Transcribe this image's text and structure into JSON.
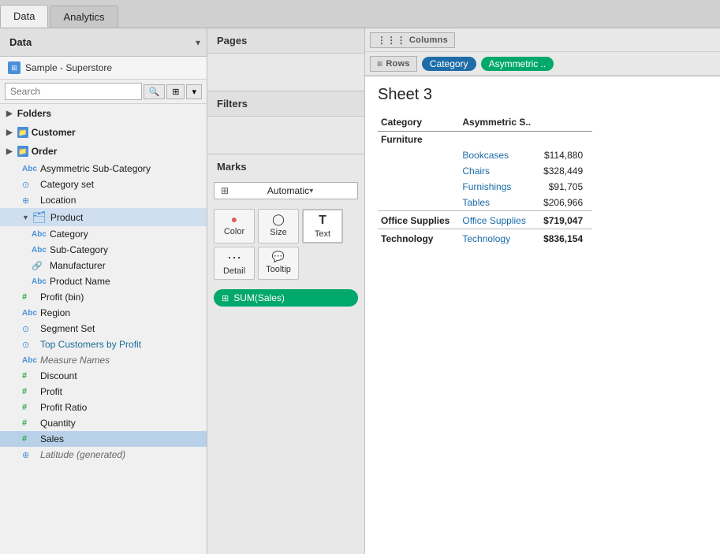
{
  "tabs": {
    "data_label": "Data",
    "analytics_label": "Analytics"
  },
  "left_panel": {
    "title": "Data",
    "datasource": "Sample - Superstore",
    "search_placeholder": "Search",
    "sections": {
      "folders_label": "Folders",
      "customer_label": "Customer",
      "order_label": "Order"
    },
    "items": [
      {
        "id": "asymmetric-sub-category",
        "icon": "Abc",
        "icon_color": "dim",
        "label": "Asymmetric Sub-Category",
        "indent": 1,
        "active": false
      },
      {
        "id": "category-set",
        "icon": "⊙",
        "icon_color": "set",
        "label": "Category set",
        "indent": 1,
        "active": false
      },
      {
        "id": "location",
        "icon": "⊕",
        "icon_color": "geo",
        "label": "Location",
        "indent": 1,
        "active": false
      },
      {
        "id": "product",
        "icon": "🗂",
        "icon_color": "dim",
        "label": "Product",
        "indent": 1,
        "active": true,
        "expanded": true
      },
      {
        "id": "category",
        "icon": "Abc",
        "icon_color": "dim",
        "label": "Category",
        "indent": 2,
        "active": false
      },
      {
        "id": "sub-category",
        "icon": "Abc",
        "icon_color": "dim",
        "label": "Sub-Category",
        "indent": 2,
        "active": false
      },
      {
        "id": "manufacturer",
        "icon": "🔗",
        "icon_color": "dim",
        "label": "Manufacturer",
        "indent": 2,
        "active": false
      },
      {
        "id": "product-name",
        "icon": "Abc",
        "icon_color": "dim",
        "label": "Product Name",
        "indent": 2,
        "active": false
      },
      {
        "id": "profit-bin",
        "icon": "#",
        "icon_color": "bin",
        "label": "Profit (bin)",
        "indent": 1,
        "active": false
      },
      {
        "id": "region",
        "icon": "Abc",
        "icon_color": "dim",
        "label": "Region",
        "indent": 1,
        "active": false
      },
      {
        "id": "segment-set",
        "icon": "⊙",
        "icon_color": "set",
        "label": "Segment Set",
        "indent": 1,
        "active": false
      },
      {
        "id": "top-customers",
        "icon": "⊙",
        "icon_color": "set",
        "label": "Top Customers by Profit",
        "indent": 1,
        "active": false,
        "blue": true
      },
      {
        "id": "measure-names",
        "icon": "Abc",
        "icon_color": "dim",
        "label": "Measure Names",
        "indent": 1,
        "active": false,
        "italic": true
      },
      {
        "id": "discount",
        "icon": "#",
        "icon_color": "measure",
        "label": "Discount",
        "indent": 1,
        "active": false
      },
      {
        "id": "profit",
        "icon": "#",
        "icon_color": "measure",
        "label": "Profit",
        "indent": 1,
        "active": false
      },
      {
        "id": "profit-ratio",
        "icon": "#",
        "icon_color": "measure",
        "label": "Profit Ratio",
        "indent": 1,
        "active": false
      },
      {
        "id": "quantity",
        "icon": "#",
        "icon_color": "measure",
        "label": "Quantity",
        "indent": 1,
        "active": false
      },
      {
        "id": "sales",
        "icon": "#",
        "icon_color": "measure",
        "label": "Sales",
        "indent": 1,
        "active": true,
        "selected": true
      },
      {
        "id": "latitude",
        "icon": "⊕",
        "icon_color": "geo",
        "label": "Latitude (generated)",
        "indent": 1,
        "active": false,
        "italic": true
      }
    ]
  },
  "middle_panel": {
    "pages_label": "Pages",
    "filters_label": "Filters",
    "marks_label": "Marks",
    "marks_type": "Automatic",
    "marks_buttons": [
      {
        "id": "color",
        "icon": "●●",
        "label": "Color"
      },
      {
        "id": "size",
        "icon": "◯",
        "label": "Size"
      },
      {
        "id": "text",
        "icon": "T",
        "label": "Text"
      },
      {
        "id": "detail",
        "icon": "⋯",
        "label": "Detail"
      },
      {
        "id": "tooltip",
        "icon": "💬",
        "label": "Tooltip"
      }
    ],
    "sum_sales_label": "SUM(Sales)"
  },
  "right_panel": {
    "columns_label": "Columns",
    "rows_label": "Rows",
    "rows_pill1": "Category",
    "rows_pill2": "Asymmetric ..",
    "sheet_title": "Sheet 3",
    "table": {
      "headers": [
        "Category",
        "Asymmetric S.."
      ],
      "rows": [
        {
          "category": "Furniture",
          "sub": "",
          "value": "",
          "is_header": true
        },
        {
          "category": "",
          "sub": "Bookcases",
          "value": "$114,880",
          "is_header": false
        },
        {
          "category": "",
          "sub": "Chairs",
          "value": "$328,449",
          "is_header": false
        },
        {
          "category": "",
          "sub": "Furnishings",
          "value": "$91,705",
          "is_header": false
        },
        {
          "category": "",
          "sub": "Tables",
          "value": "$206,966",
          "is_header": false
        },
        {
          "category": "Office Supplies",
          "sub": "Office Supplies",
          "value": "$719,047",
          "is_header": true
        },
        {
          "category": "Technology",
          "sub": "Technology",
          "value": "$836,154",
          "is_header": true
        }
      ]
    }
  },
  "colors": {
    "tab_active_bg": "#f0f0f0",
    "shelf_pill_blue": "#1e6da8",
    "shelf_pill_green": "#00a86b",
    "sum_sales_green": "#00a86b",
    "blue_link": "#1a6ba8"
  }
}
